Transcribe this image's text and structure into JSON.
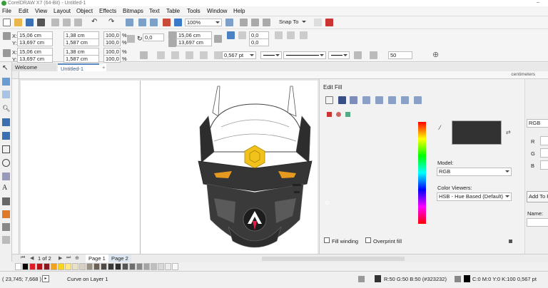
{
  "window": {
    "title": "CorelDRAW X7 (64-Bit) - Untitled-1"
  },
  "menu": [
    "File",
    "Edit",
    "View",
    "Layout",
    "Object",
    "Effects",
    "Bitmaps",
    "Text",
    "Table",
    "Tools",
    "Window",
    "Help"
  ],
  "toolbar": {
    "zoom": "100%",
    "snap_to": "Snap To"
  },
  "props": {
    "x": "15,06 cm",
    "y": "13,697 cm",
    "width": "1,38 cm",
    "height": "1,587 cm",
    "scale_x": "100,0",
    "scale_y": "100,0",
    "pct": "%",
    "rotation": "0,0",
    "x2": "15,06 cm",
    "y2": "13,697 cm",
    "angle2": "0,0",
    "angle3": "0,0",
    "x_label": "X:",
    "y_label": "Y:",
    "outline_width": "0,567 pt",
    "smoothing": "50"
  },
  "tabs": {
    "welcome": "Welcome Screen",
    "doc": "Untitled-1"
  },
  "ruler": {
    "unit": "centimeters"
  },
  "edit_fill": {
    "title": "Edit Fill",
    "model_label": "Model:",
    "model_value": "RGB",
    "viewers_label": "Color Viewers:",
    "viewers_value": "HSB - Hue Based (Default)",
    "mode_value": "RGB",
    "r_label": "R",
    "g_label": "G",
    "b_label": "B",
    "add_to_label": "Add To P",
    "name_label": "Name:",
    "fill_winding": "Fill winding",
    "overprint_fill": "Overprint fill",
    "swatch_color": "#323232"
  },
  "nav": {
    "page_count": "1 of 2",
    "page1": "Page 1",
    "page2": "Page 2"
  },
  "palette_colors": [
    "#ffffff",
    "#000000",
    "#e11d26",
    "#b8131a",
    "#8a1a1d",
    "#f4a11c",
    "#fbd51c",
    "#ffe789",
    "#ebe0c8",
    "#d7d1c5",
    "#9a8f83",
    "#6d6255",
    "#4f4a47",
    "#3a3a3a",
    "#2d2d2d",
    "#555555",
    "#6e6e6e",
    "#888888",
    "#a3a3a3",
    "#bfbfbf",
    "#d9d9d9",
    "#ececec",
    "#f8f8f8"
  ],
  "status": {
    "coords": "( 23,745; 7,668 )",
    "layer_info": "Curve on Layer 1",
    "fill_info": "R:50 G:50 B:50 (#323232)",
    "outline_info": "C:0 M:0 Y:0 K:100  0,567 pt"
  }
}
